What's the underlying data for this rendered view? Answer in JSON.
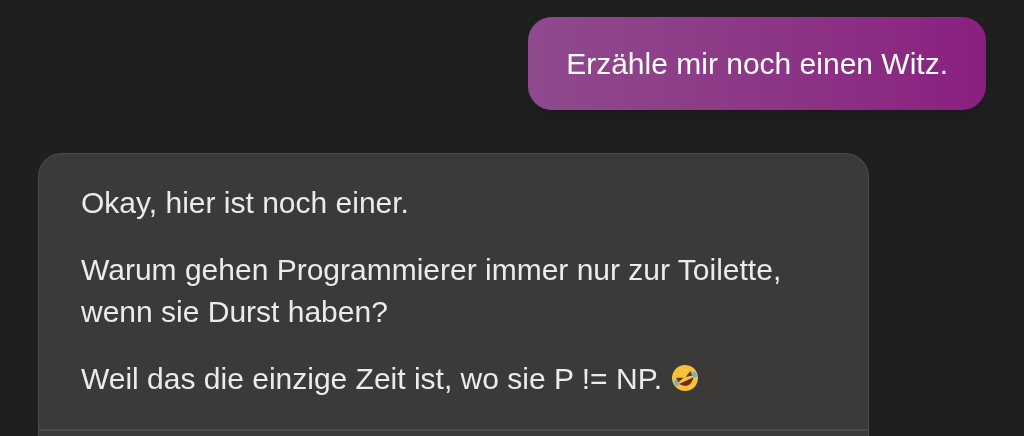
{
  "messages": [
    {
      "kind": "user",
      "paragraphs": [
        "Erzähle mir noch einen Witz."
      ]
    },
    {
      "kind": "assistant",
      "paragraphs": [
        "Okay, hier ist noch einer.",
        "Warum gehen Programmierer immer nur zur Toilette, wenn sie Durst haben?",
        "Weil das die einzige Zeit ist, wo sie P != NP."
      ],
      "emoji": true
    }
  ]
}
